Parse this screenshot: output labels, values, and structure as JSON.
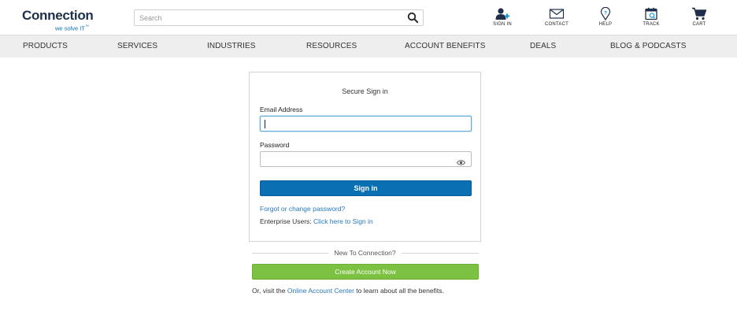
{
  "header": {
    "logo_word": "Connection",
    "logo_tagline": "we solve IT",
    "search_placeholder": "Search",
    "utilities": [
      {
        "label": "SIGN IN",
        "icon": "user-plus-icon"
      },
      {
        "label": "CONTACT",
        "icon": "envelope-icon"
      },
      {
        "label": "HELP",
        "icon": "help-pin-icon"
      },
      {
        "label": "TRACK",
        "icon": "calendar-track-icon"
      },
      {
        "label": "CART",
        "icon": "cart-icon"
      }
    ]
  },
  "nav": {
    "items": [
      "PRODUCTS",
      "SERVICES",
      "INDUSTRIES",
      "RESOURCES",
      "ACCOUNT BENEFITS",
      "DEALS",
      "BLOG & PODCASTS"
    ]
  },
  "signin": {
    "title": "Secure Sign in",
    "email_label": "Email Address",
    "email_value": "",
    "password_label": "Password",
    "password_value": "",
    "button_label": "Sign in",
    "forgot_link": "Forgot or change password?",
    "enterprise_prefix": "Enterprise Users: ",
    "enterprise_link": "Click here to Sign in"
  },
  "signup": {
    "divider_text": "New To Connection?",
    "create_button": "Create Account Now",
    "visit_prefix": "Or, visit the ",
    "visit_link": "Online Account Center",
    "visit_suffix": " to learn about all the benefits."
  },
  "colors": {
    "brand_navy": "#1f2f4a",
    "brand_blue": "#0a6fb3",
    "cta_green": "#7cc142",
    "nav_bg": "#eeeeee"
  }
}
